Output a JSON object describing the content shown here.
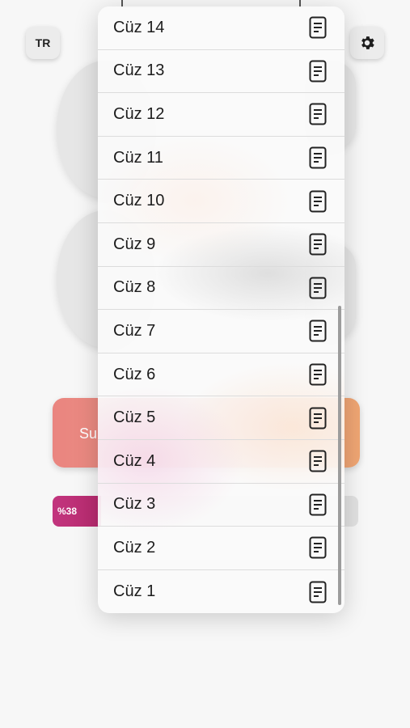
{
  "header": {
    "language_label": "TR",
    "settings_icon": "gear-icon"
  },
  "submit": {
    "label_fragment": "Su"
  },
  "progress": {
    "text": "%38",
    "value": 0.38
  },
  "menu": {
    "items": [
      {
        "label": "Cüz 14",
        "icon": "document-icon"
      },
      {
        "label": "Cüz 13",
        "icon": "document-icon"
      },
      {
        "label": "Cüz 12",
        "icon": "document-icon"
      },
      {
        "label": "Cüz 11",
        "icon": "document-icon"
      },
      {
        "label": "Cüz 10",
        "icon": "document-icon"
      },
      {
        "label": "Cüz 9",
        "icon": "document-icon"
      },
      {
        "label": "Cüz 8",
        "icon": "document-icon"
      },
      {
        "label": "Cüz 7",
        "icon": "document-icon"
      },
      {
        "label": "Cüz 6",
        "icon": "document-icon"
      },
      {
        "label": "Cüz 5",
        "icon": "document-icon"
      },
      {
        "label": "Cüz 4",
        "icon": "document-icon"
      },
      {
        "label": "Cüz 3",
        "icon": "document-icon"
      },
      {
        "label": "Cüz 2",
        "icon": "document-icon"
      },
      {
        "label": "Cüz 1",
        "icon": "document-icon"
      }
    ]
  },
  "colors": {
    "submit_gradient_start": "#ea8580",
    "submit_gradient_end": "#f0a673",
    "progress_fill": "#c2357e"
  }
}
